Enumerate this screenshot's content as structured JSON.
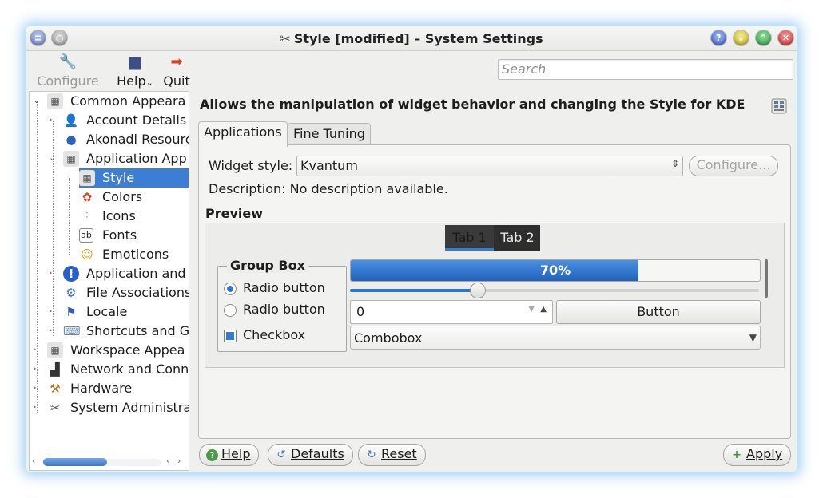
{
  "window": {
    "title": "Style [modified] – System Settings",
    "title_icon": "tools-icon"
  },
  "toolbar": {
    "configure_label": "Configure",
    "help_label": "Help",
    "quit_label": "Quit"
  },
  "search": {
    "placeholder": "Search",
    "value": ""
  },
  "tree": {
    "items": [
      {
        "label": "Common Appeara",
        "icon": "appearance-icon",
        "expander": "collapse"
      },
      {
        "label": "Account Details",
        "icon": "user-icon",
        "expander": "expand"
      },
      {
        "label": "Akonadi Resourc",
        "icon": "akonadi-icon",
        "expander": ""
      },
      {
        "label": "Application App",
        "icon": "appearance-icon",
        "expander": "collapse"
      },
      {
        "label": "Style",
        "icon": "style-icon",
        "expander": ""
      },
      {
        "label": "Colors",
        "icon": "colors-icon",
        "expander": ""
      },
      {
        "label": "Icons",
        "icon": "icons-icon",
        "expander": ""
      },
      {
        "label": "Fonts",
        "icon": "fonts-icon",
        "expander": ""
      },
      {
        "label": "Emoticons",
        "icon": "emoticons-icon",
        "expander": ""
      },
      {
        "label": "Application and",
        "icon": "notification-icon",
        "expander": "expand"
      },
      {
        "label": "File Associations",
        "icon": "file-associations-icon",
        "expander": ""
      },
      {
        "label": "Locale",
        "icon": "flag-icon",
        "expander": "expand"
      },
      {
        "label": "Shortcuts and G",
        "icon": "shortcuts-icon",
        "expander": "expand"
      },
      {
        "label": "Workspace Appea",
        "icon": "appearance-icon",
        "expander": "expand"
      },
      {
        "label": "Network and Conn",
        "icon": "network-icon",
        "expander": "expand"
      },
      {
        "label": "Hardware",
        "icon": "hardware-icon",
        "expander": "expand"
      },
      {
        "label": "System Administra",
        "icon": "admin-icon",
        "expander": "expand"
      }
    ]
  },
  "main": {
    "heading": "Allows the manipulation of widget behavior and changing the Style for KDE",
    "tabs": [
      {
        "label": "Applications",
        "active": true
      },
      {
        "label": "Fine Tuning",
        "active": false
      }
    ],
    "widget_style_label": "Widget style:",
    "widget_style_value": "Kvantum",
    "configure_label": "Configure...",
    "description": "Description: No description available.",
    "preview_label": "Preview"
  },
  "preview": {
    "tabs": [
      "Tab 1",
      "Tab 2"
    ],
    "group_box_title": "Group Box",
    "radio1_label": "Radio button",
    "radio2_label": "Radio button",
    "checkbox_label": "Checkbox",
    "progress_text": "70%",
    "progress_value": 0.7,
    "slider_value": 0.31,
    "spin_value": "0",
    "button_label": "Button",
    "combobox_value": "Combobox"
  },
  "footer": {
    "help_label": "Help",
    "defaults_label": "Defaults",
    "reset_label": "Reset",
    "apply_label": "Apply"
  },
  "colors": {
    "accent": "#3b7ed3",
    "help_btn": "#4a6fd6",
    "minimize_btn": "#d6c93a",
    "maximize_btn": "#3aa84a",
    "close_btn": "#d64141"
  }
}
